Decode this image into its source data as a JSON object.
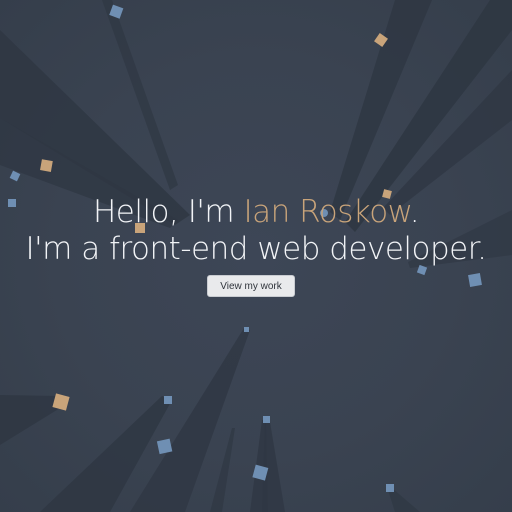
{
  "hero": {
    "line1_prefix": "Hello, I'm ",
    "name": "Ian Roskow",
    "line1_suffix": ".",
    "line2": "I'm a front-end web developer."
  },
  "cta": {
    "label": "View my work"
  },
  "colors": {
    "background": "#3b4452",
    "beam": "#2f3743",
    "accent_tan": "#c9a47a",
    "accent_blue": "#6f8fb3",
    "text": "#f2f4f7"
  }
}
